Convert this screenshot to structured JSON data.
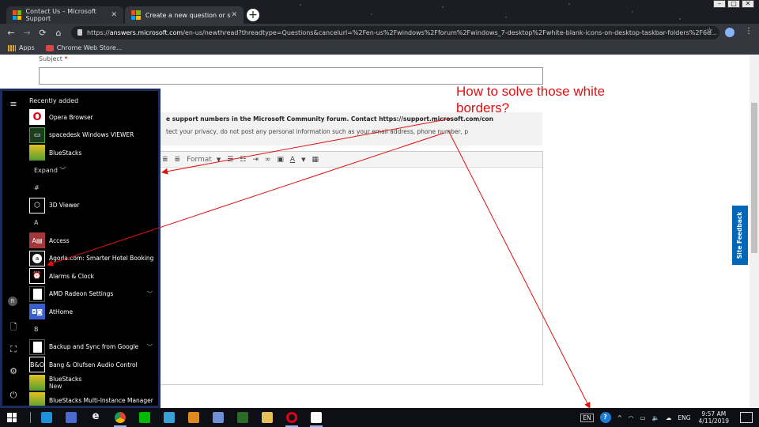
{
  "browser": {
    "tabs": [
      {
        "title": "Contact Us – Microsoft Support",
        "active": false
      },
      {
        "title": "Create a new question or start a",
        "active": true
      }
    ],
    "url_scheme": "https://",
    "url_host": "answers.microsoft.com",
    "url_path": "/en-us/newthread?threadtype=Questions&cancelurl=%2Fen-us%2Fwindows%2Fforum%2Fwindows_7-desktop%2Fwhite-blank-icons-on-desktop-taskbar-folders%2F6d...",
    "bookmarks": [
      {
        "label": "Apps"
      },
      {
        "label": "Chrome Web Store..."
      }
    ]
  },
  "page": {
    "subject_label": "Subject",
    "required_mark": "*",
    "notice_line1": "e support numbers in the Microsoft Community forum. Contact https://support.microsoft.com/con",
    "notice_line2": "tect your privacy, do not post any personal information such as your email address, phone number, p",
    "editor_format_label": "Format",
    "site_feedback": "Site Feedback",
    "annotation": "How to solve those white borders?"
  },
  "start_menu": {
    "recently_added_label": "Recently added",
    "recent": [
      {
        "label": "Opera Browser",
        "icon": "opera-icon"
      },
      {
        "label": "spacedesk Windows VIEWER",
        "icon": "spacedesk-icon"
      },
      {
        "label": "BlueStacks",
        "icon": "bluestacks-icon"
      }
    ],
    "expand_label": "Expand",
    "groups": [
      {
        "letter": "#",
        "apps": [
          {
            "label": "3D Viewer",
            "icon": "cube-icon"
          }
        ]
      },
      {
        "letter": "A",
        "apps": [
          {
            "label": "Access",
            "icon": "access-icon"
          },
          {
            "label": "Agoda.com: Smarter Hotel Booking",
            "icon": "agoda-icon"
          },
          {
            "label": "Alarms & Clock",
            "icon": "alarm-icon"
          },
          {
            "label": "AMD Radeon Settings",
            "icon": "blank-icon",
            "expandable": true
          },
          {
            "label": "AtHome",
            "icon": "athome-icon"
          }
        ]
      },
      {
        "letter": "B",
        "apps": [
          {
            "label": "Backup and Sync from Google",
            "icon": "blank-icon",
            "expandable": true
          },
          {
            "label": "Bang & Olufsen Audio Control",
            "icon": "bo-icon"
          },
          {
            "label": "BlueStacks",
            "sub": "New",
            "icon": "bluestacks-icon"
          },
          {
            "label": "BlueStacks Multi-Instance Manager",
            "icon": "bluestacks-icon"
          }
        ]
      }
    ]
  },
  "taskbar": {
    "apps": [
      {
        "icon": "store-icon",
        "color": "#1e90d8",
        "open": false
      },
      {
        "icon": "desktop-icon",
        "color": "#4b6bd1",
        "open": false
      },
      {
        "icon": "edge-icon",
        "color": "#0d0f14",
        "open": false
      },
      {
        "icon": "chrome-icon",
        "color": "#f2a900",
        "open": true
      },
      {
        "icon": "line-icon",
        "color": "#00b900",
        "open": false
      },
      {
        "icon": "file-icon",
        "color": "#3aa0d8",
        "open": false
      },
      {
        "icon": "star-icon",
        "color": "#e08a1e",
        "open": false
      },
      {
        "icon": "remote-icon",
        "color": "#6f8fd8",
        "open": false
      },
      {
        "icon": "spacedesk-icon",
        "color": "#2a6b2a",
        "open": false
      },
      {
        "icon": "folder-icon",
        "color": "#e5c158",
        "open": false
      },
      {
        "icon": "opera-icon",
        "color": "#e0001a",
        "open": true
      },
      {
        "icon": "chat-icon",
        "color": "#ffffff",
        "open": true
      }
    ],
    "input_indicator": "EN",
    "language": "ENG",
    "time": "9:57 AM",
    "date": "4/11/2019"
  },
  "colors": {
    "annotation_red": "#e01010",
    "start_border": "#1d2a5c",
    "feedback_blue": "#0067b8"
  }
}
